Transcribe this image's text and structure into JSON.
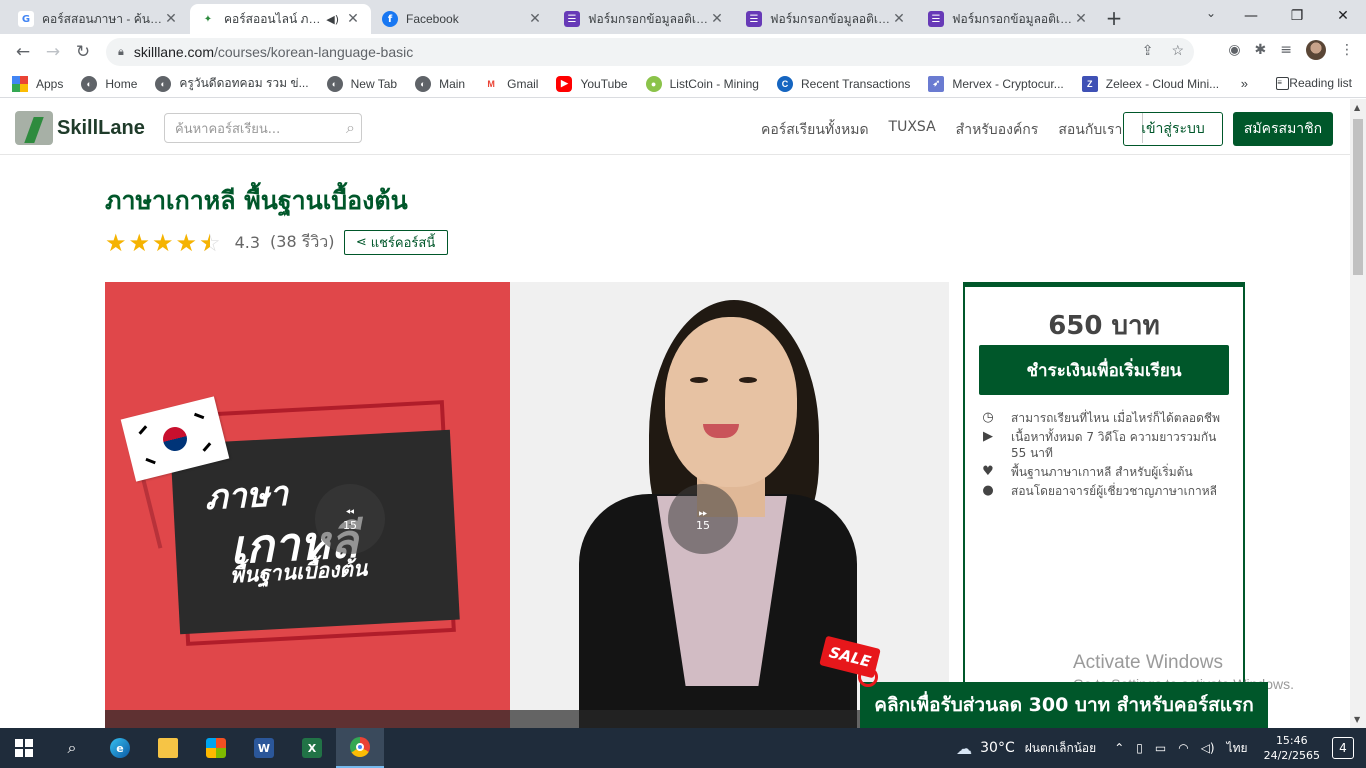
{
  "browser": {
    "tabs": [
      {
        "title": "คอร์สสอนภาษา - ค้นหาด้วย Google",
        "favicon": "google-icon",
        "active": false
      },
      {
        "title": "คอร์สออนไลน์ ภาษาเกาหลี",
        "favicon": "skilllane-icon",
        "active": true
      },
      {
        "title": "Facebook",
        "favicon": "facebook-icon",
        "active": false
      },
      {
        "title": "ฟอร์มกรอกข้อมูลอติเรก",
        "favicon": "forms-icon",
        "active": false
      },
      {
        "title": "ฟอร์มกรอกข้อมูลอติเรก",
        "favicon": "forms-icon",
        "active": false
      },
      {
        "title": "ฟอร์มกรอกข้อมูลอติเรก",
        "favicon": "forms-icon",
        "active": false
      }
    ],
    "url_host": "skilllane.com",
    "url_path": "/courses/korean-language-basic",
    "bookmarks": [
      {
        "label": "Apps",
        "icon": "apps-grid-icon",
        "color": "#ea4335"
      },
      {
        "label": "Home",
        "icon": "globe-icon",
        "color": "#5f6368"
      },
      {
        "label": "ครูวันดีดอทคอม รวม ข่...",
        "icon": "globe-icon",
        "color": "#5f6368"
      },
      {
        "label": "New Tab",
        "icon": "globe-icon",
        "color": "#5f6368"
      },
      {
        "label": "Main",
        "icon": "globe-icon",
        "color": "#5f6368"
      },
      {
        "label": "Gmail",
        "icon": "gmail-icon",
        "color": "#ea4335"
      },
      {
        "label": "YouTube",
        "icon": "youtube-icon",
        "color": "#ff0000"
      },
      {
        "label": "ListCoin - Mining",
        "icon": "listcoin-icon",
        "color": "#8bc34a"
      },
      {
        "label": "Recent Transactions",
        "icon": "coin-icon",
        "color": "#1565c0"
      },
      {
        "label": "Mervex - Cryptocur...",
        "icon": "mervex-icon",
        "color": "#6a7bd1"
      },
      {
        "label": "Zeleex - Cloud Mini...",
        "icon": "zeleex-icon",
        "color": "#3f51b5"
      }
    ],
    "reading_list": "Reading list",
    "more": "»"
  },
  "site": {
    "logo_text": "SkillLane",
    "search_placeholder": "ค้นหาคอร์สเรียน...",
    "nav": [
      "คอร์สเรียนทั้งหมด",
      "TUXSA",
      "สำหรับองค์กร",
      "สอนกับเรา"
    ],
    "login": "เข้าสู่ระบบ",
    "signup": "สมัครสมาชิก"
  },
  "course": {
    "title": "ภาษาเกาหลี  พื้นฐานเบื้องต้น",
    "rating": "4.3",
    "rating_value": 4.3,
    "reviews": "(38  รีวิว)",
    "share": "แชร์คอร์สนี้",
    "thumb_line1": "ภาษา",
    "thumb_line2": "เกาหลี",
    "thumb_line3": "พื้นฐานเบื้องต้น",
    "skip_back": "15",
    "skip_forward": "15"
  },
  "purchase": {
    "price": "650  บาท",
    "buy": "ชำระเงินเพื่อเริ่มเรียน",
    "features": [
      {
        "icon": "clock-icon",
        "glyph": "◷",
        "text": "สามารถเรียนที่ไหน  เมื่อไหร่ก็ได้ตลอดชีพ"
      },
      {
        "icon": "play-icon",
        "glyph": "▶",
        "text": "เนื้อหาทั้งหมด  7  วิดีโอ  ความยาวรวมกัน  55  นาที"
      },
      {
        "icon": "heart-icon",
        "glyph": "♥",
        "text": "พื้นฐานภาษาเกาหลี  สำหรับผู้เริ่มต้น"
      },
      {
        "icon": "user-icon",
        "glyph": "●",
        "text": "สอนโดยอาจารย์ผู้เชี่ยวชาญภาษาเกาหลี"
      }
    ]
  },
  "promo": {
    "sale": "SALE",
    "banner": "คลิกเพื่อรับส่วนลด 300 บาท สำหรับคอร์สแรก"
  },
  "watermark": {
    "line1": "Activate Windows",
    "line2": "Go to Settings to activate Windows."
  },
  "taskbar": {
    "weather_temp": "30°C",
    "weather_desc": "ฝนตกเล็กน้อย",
    "lang": "ไทย",
    "time": "15:46",
    "date": "24/2/2565",
    "notifications": "4"
  },
  "colors": {
    "brand_green": "#00572a",
    "star": "#f5b301",
    "sale_red": "#e7171b"
  }
}
